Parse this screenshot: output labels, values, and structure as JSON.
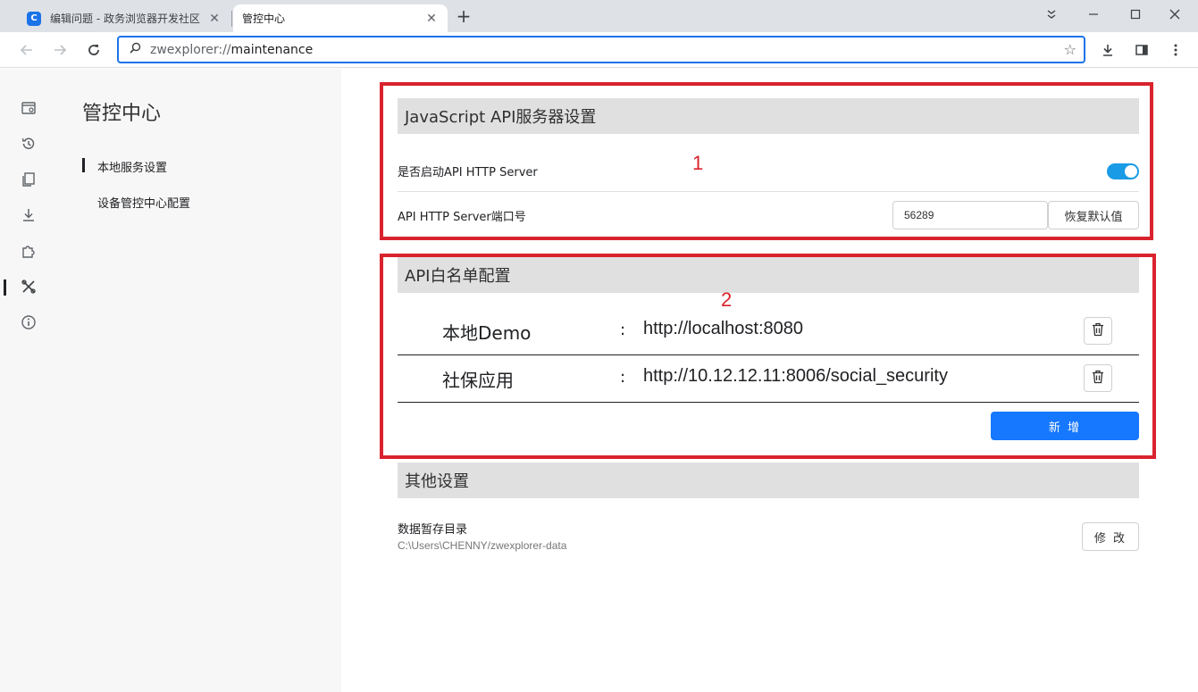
{
  "tabs": [
    {
      "title": "编辑问题 - 政务浏览器开发社区",
      "favicon": "C",
      "active": false
    },
    {
      "title": "管控中心",
      "active": true
    }
  ],
  "toolbar": {
    "url_scheme": "zwexplorer://",
    "url_path": "maintenance"
  },
  "sidebar": {
    "title": "管控中心",
    "items": [
      {
        "label": "本地服务设置",
        "selected": true
      },
      {
        "label": "设备管控中心配置",
        "selected": false
      }
    ]
  },
  "api_server": {
    "title": "JavaScript API服务器设置",
    "enable_label": "是否启动API HTTP Server",
    "enabled": true,
    "port_label": "API HTTP Server端口号",
    "port_value": "56289",
    "reset_label": "恢复默认值"
  },
  "whitelist": {
    "title": "API白名单配置",
    "entries": [
      {
        "name": "本地Demo",
        "separator": ":",
        "url": "http://localhost:8080"
      },
      {
        "name": "社保应用",
        "separator": ":",
        "url": "http://10.12.12.11:8006/social_security"
      }
    ],
    "add_label": "新 增"
  },
  "other": {
    "title": "其他设置",
    "dir_label": "数据暂存目录",
    "dir_path": "C:\\Users\\CHENNY/zwexplorer-data",
    "modify_label": "修 改"
  },
  "annotations": [
    "1",
    "2"
  ],
  "colors": {
    "accent": "#1677ff",
    "toggle_on": "#1a9be6",
    "annotation": "#d9232d",
    "section_header": "#e0e0e0"
  }
}
